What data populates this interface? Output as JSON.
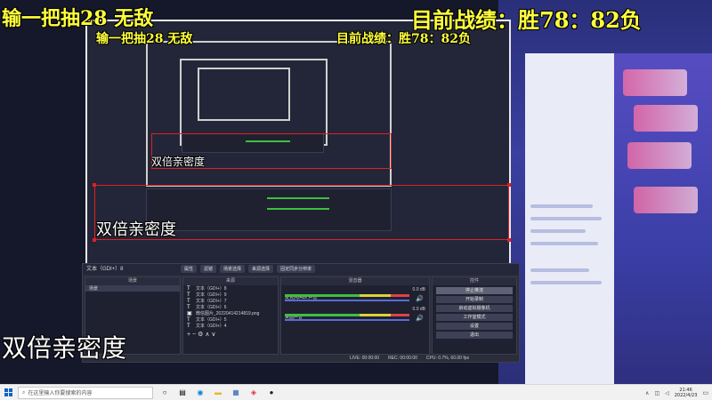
{
  "overlay": {
    "top_left": "输一把抽28 无敌",
    "top_right": "目前战绩：胜78：82负",
    "nested_top_left": "输一把抽28 无敌",
    "nested_top_right": "目前战绩：胜78：82负",
    "label_large": "双倍亲密度",
    "label_mid": "双倍亲密度",
    "label_small": "双倍亲密度"
  },
  "obs": {
    "preview_label": "文本（GDI+）8",
    "tab_properties": "属性",
    "tab_filters": "滤镜",
    "tab_scene_select": "场景选择",
    "tab_sources_select": "来源选择",
    "tab_pin": "固定同步分辨率",
    "scenes_header": "场景",
    "scene_item": "场景",
    "sources_header": "来源",
    "sources": [
      "文本（GDI+）8",
      "文本（GDI+）9",
      "文本（GDI+）7",
      "文本（GDI+）6",
      "微信图片_20220414214819.png",
      "文本（GDI+）5",
      "文本（GDI+）4"
    ],
    "mixer_header": "混音器",
    "mixer": [
      {
        "name": "麦克风/Aux 声音",
        "db": "0.0 dB"
      },
      {
        "name": "桌面声音",
        "db": "0.0 dB"
      }
    ],
    "controls_header": "控件",
    "controls": [
      "停止推流",
      "开始录制",
      "启动虚拟摄像机",
      "工作室模式",
      "设置",
      "退出"
    ],
    "status": {
      "live": "LIVE: 00:00:00",
      "rec": "REC: 00:00:00",
      "cpu": "CPU: 0.7%, 60.00 fps"
    }
  },
  "taskbar": {
    "search_placeholder": "在这里输入你要搜索的内容",
    "time": "21:46",
    "date": "2022/4/23"
  },
  "colors": {
    "overlay_yellow": "#ffff3c",
    "overlay_white": "#ffffff",
    "selection_red": "#e02020",
    "windows_blue": "#0a64c8"
  }
}
